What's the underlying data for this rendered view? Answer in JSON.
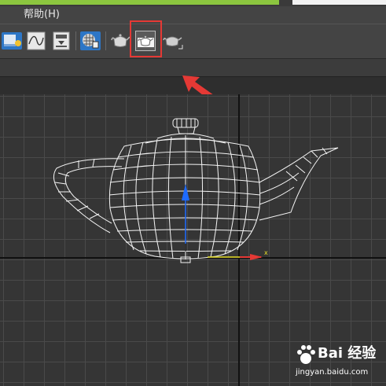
{
  "menubar": {
    "help_label": "帮助(H)"
  },
  "toolbar": {
    "icons": [
      "render-setup-icon",
      "curve-editor-icon",
      "render-frame-window-icon",
      "material-editor-icon",
      "render-production-icon",
      "render-teapot-icon",
      "render-iterative-icon"
    ],
    "selected": "render-teapot-icon",
    "highlight_color": "#e53935",
    "arrow_color": "#e53935"
  },
  "viewport": {
    "axis_label_x": "x",
    "axis_colors": {
      "x": "#e53935",
      "y": "#e8e028",
      "z": "#1e6bff"
    },
    "wireframe_color": "#ffffff"
  },
  "watermark": {
    "main": "Bai 经验",
    "sub": "jingyan.baidu.com"
  }
}
